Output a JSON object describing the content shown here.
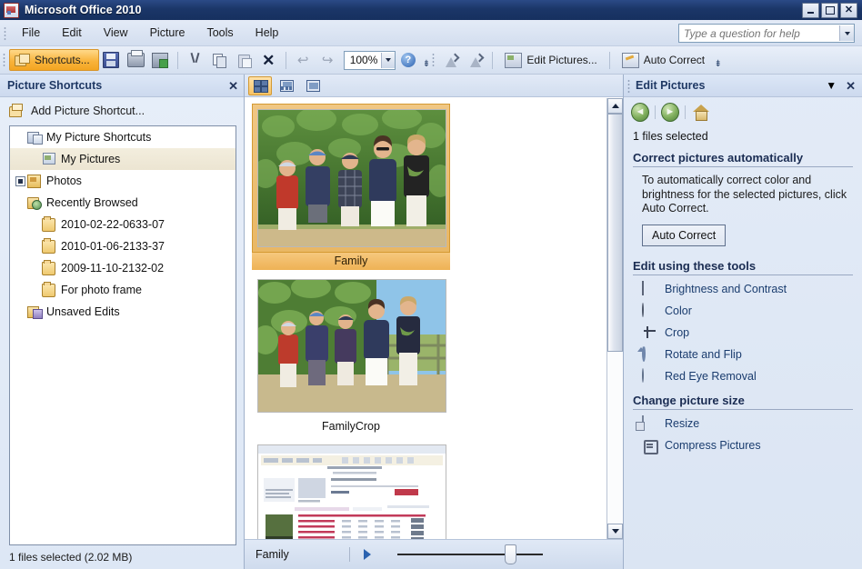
{
  "window": {
    "title": "Microsoft Office 2010",
    "icon": "picture-manager-icon",
    "minimize_label": "_",
    "maximize_label": "",
    "close_label": "✕"
  },
  "menu": {
    "items": [
      {
        "label": "File"
      },
      {
        "label": "Edit"
      },
      {
        "label": "View"
      },
      {
        "label": "Picture"
      },
      {
        "label": "Tools"
      },
      {
        "label": "Help"
      }
    ],
    "help_search": {
      "placeholder": "Type a question for help",
      "value": ""
    }
  },
  "toolbar": {
    "shortcuts_label": "Shortcuts...",
    "zoom_value": "100%",
    "edit_pictures_label": "Edit Pictures...",
    "auto_correct_label": "Auto Correct",
    "buttons": [
      {
        "name": "save-button",
        "icon": "save-icon"
      },
      {
        "name": "print-button",
        "icon": "print-icon"
      },
      {
        "name": "export-button",
        "icon": "export-icon"
      },
      {
        "name": "cut-button",
        "icon": "scissors-icon"
      },
      {
        "name": "copy-button",
        "icon": "copy-icon"
      },
      {
        "name": "paste-button",
        "icon": "paste-icon"
      },
      {
        "name": "delete-button",
        "icon": "close-x-icon"
      },
      {
        "name": "undo-button",
        "icon": "undo-arrow-icon"
      },
      {
        "name": "redo-button",
        "icon": "redo-arrow-icon"
      }
    ]
  },
  "sidebar": {
    "title": "Picture Shortcuts",
    "close_label": "✕",
    "add_shortcut_label": "Add Picture Shortcut...",
    "tree": [
      {
        "label": "My Picture Shortcuts",
        "indent": 0,
        "icon": "shortcuts-folder-icon",
        "selected": false,
        "expander": false
      },
      {
        "label": "My Pictures",
        "indent": 1,
        "icon": "my-pictures-icon",
        "selected": true,
        "expander": false
      },
      {
        "label": "Photos",
        "indent": 0,
        "icon": "photos-folder-icon",
        "selected": false,
        "expander": true
      },
      {
        "label": "Recently Browsed",
        "indent": 0,
        "icon": "recently-browsed-icon",
        "selected": false,
        "expander": false
      },
      {
        "label": "2010-02-22-0633-07",
        "indent": 1,
        "icon": "folder-icon",
        "selected": false,
        "expander": false
      },
      {
        "label": "2010-01-06-2133-37",
        "indent": 1,
        "icon": "folder-icon",
        "selected": false,
        "expander": false
      },
      {
        "label": "2009-11-10-2132-02",
        "indent": 1,
        "icon": "folder-icon",
        "selected": false,
        "expander": false
      },
      {
        "label": "For photo frame",
        "indent": 1,
        "icon": "folder-icon",
        "selected": false,
        "expander": false
      },
      {
        "label": "Unsaved Edits",
        "indent": 0,
        "icon": "unsaved-edits-icon",
        "selected": false,
        "expander": false
      }
    ],
    "status": "1 files selected (2.02 MB)"
  },
  "viewbar": {
    "buttons": [
      {
        "name": "thumbnail-view-button",
        "icon": "thumbnail-grid-icon",
        "active": true
      },
      {
        "name": "filmstrip-view-button",
        "icon": "filmstrip-icon",
        "active": false
      },
      {
        "name": "single-picture-view-button",
        "icon": "single-picture-icon",
        "active": false
      }
    ]
  },
  "thumbnails": [
    {
      "caption": "Family",
      "selected": true,
      "kind": "family-group-photo"
    },
    {
      "caption": "FamilyCrop",
      "selected": false,
      "kind": "family-group-photo-cropped"
    },
    {
      "caption": "",
      "selected": false,
      "kind": "screenshot-webpage"
    }
  ],
  "filmbar": {
    "current_name": "Family",
    "next_label": "▶",
    "zoom_position_pct": 74
  },
  "taskpane": {
    "title": "Edit Pictures",
    "caret_label": "▼",
    "close_label": "✕",
    "nav": [
      {
        "name": "back-button",
        "icon": "back-arrow-icon",
        "glyph": "◄"
      },
      {
        "name": "forward-button",
        "icon": "forward-arrow-icon",
        "glyph": "►"
      },
      {
        "name": "home-button",
        "icon": "home-icon",
        "glyph": ""
      }
    ],
    "selection_status": "1 files selected",
    "auto_section": {
      "heading": "Correct pictures automatically",
      "description": "To automatically correct color and brightness for the selected pictures, click Auto Correct.",
      "button_label": "Auto Correct"
    },
    "tools_section": {
      "heading": "Edit using these tools",
      "items": [
        {
          "label": "Brightness and Contrast",
          "icon": "brightness-contrast-icon"
        },
        {
          "label": "Color",
          "icon": "color-wheel-icon"
        },
        {
          "label": "Crop",
          "icon": "crop-icon"
        },
        {
          "label": "Rotate and Flip",
          "icon": "rotate-flip-icon"
        },
        {
          "label": "Red Eye Removal",
          "icon": "red-eye-icon"
        }
      ]
    },
    "size_section": {
      "heading": "Change picture size",
      "items": [
        {
          "label": "Resize",
          "icon": "resize-icon"
        },
        {
          "label": "Compress Pictures",
          "icon": "compress-icon"
        }
      ]
    }
  },
  "colors": {
    "titlebar": "#1b3668",
    "accent_orange": "#f3a521",
    "link_blue": "#1a3c6e",
    "heading_navy": "#1a2c52"
  }
}
